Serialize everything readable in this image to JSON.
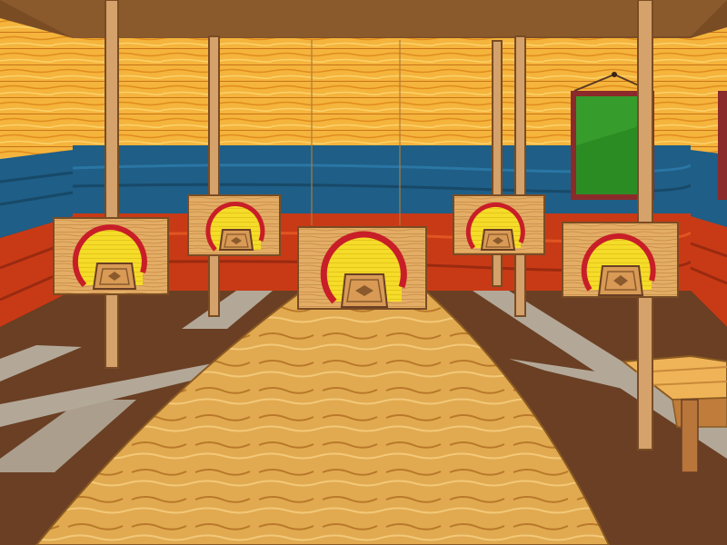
{
  "scene": {
    "name": "basketball-hoop-gym",
    "colors": {
      "wall_wood": "#f5b43c",
      "wall_wood_dark": "#d8861c",
      "wall_blue": "#1f5e86",
      "wall_red": "#c83a16",
      "floor_brown": "#6a3f24",
      "floor_lines": "#b3a898",
      "rug": "#e1aa50",
      "board_wood": "#e0a860",
      "hoop_red": "#c81e28",
      "hoop_yellow": "#f5dc28",
      "chalkboard_green": "#2c8c24",
      "pole": "#d4a26a"
    }
  },
  "targets": [
    {
      "id": "target-1"
    },
    {
      "id": "target-2"
    },
    {
      "id": "target-3"
    },
    {
      "id": "target-4"
    },
    {
      "id": "target-5"
    }
  ]
}
